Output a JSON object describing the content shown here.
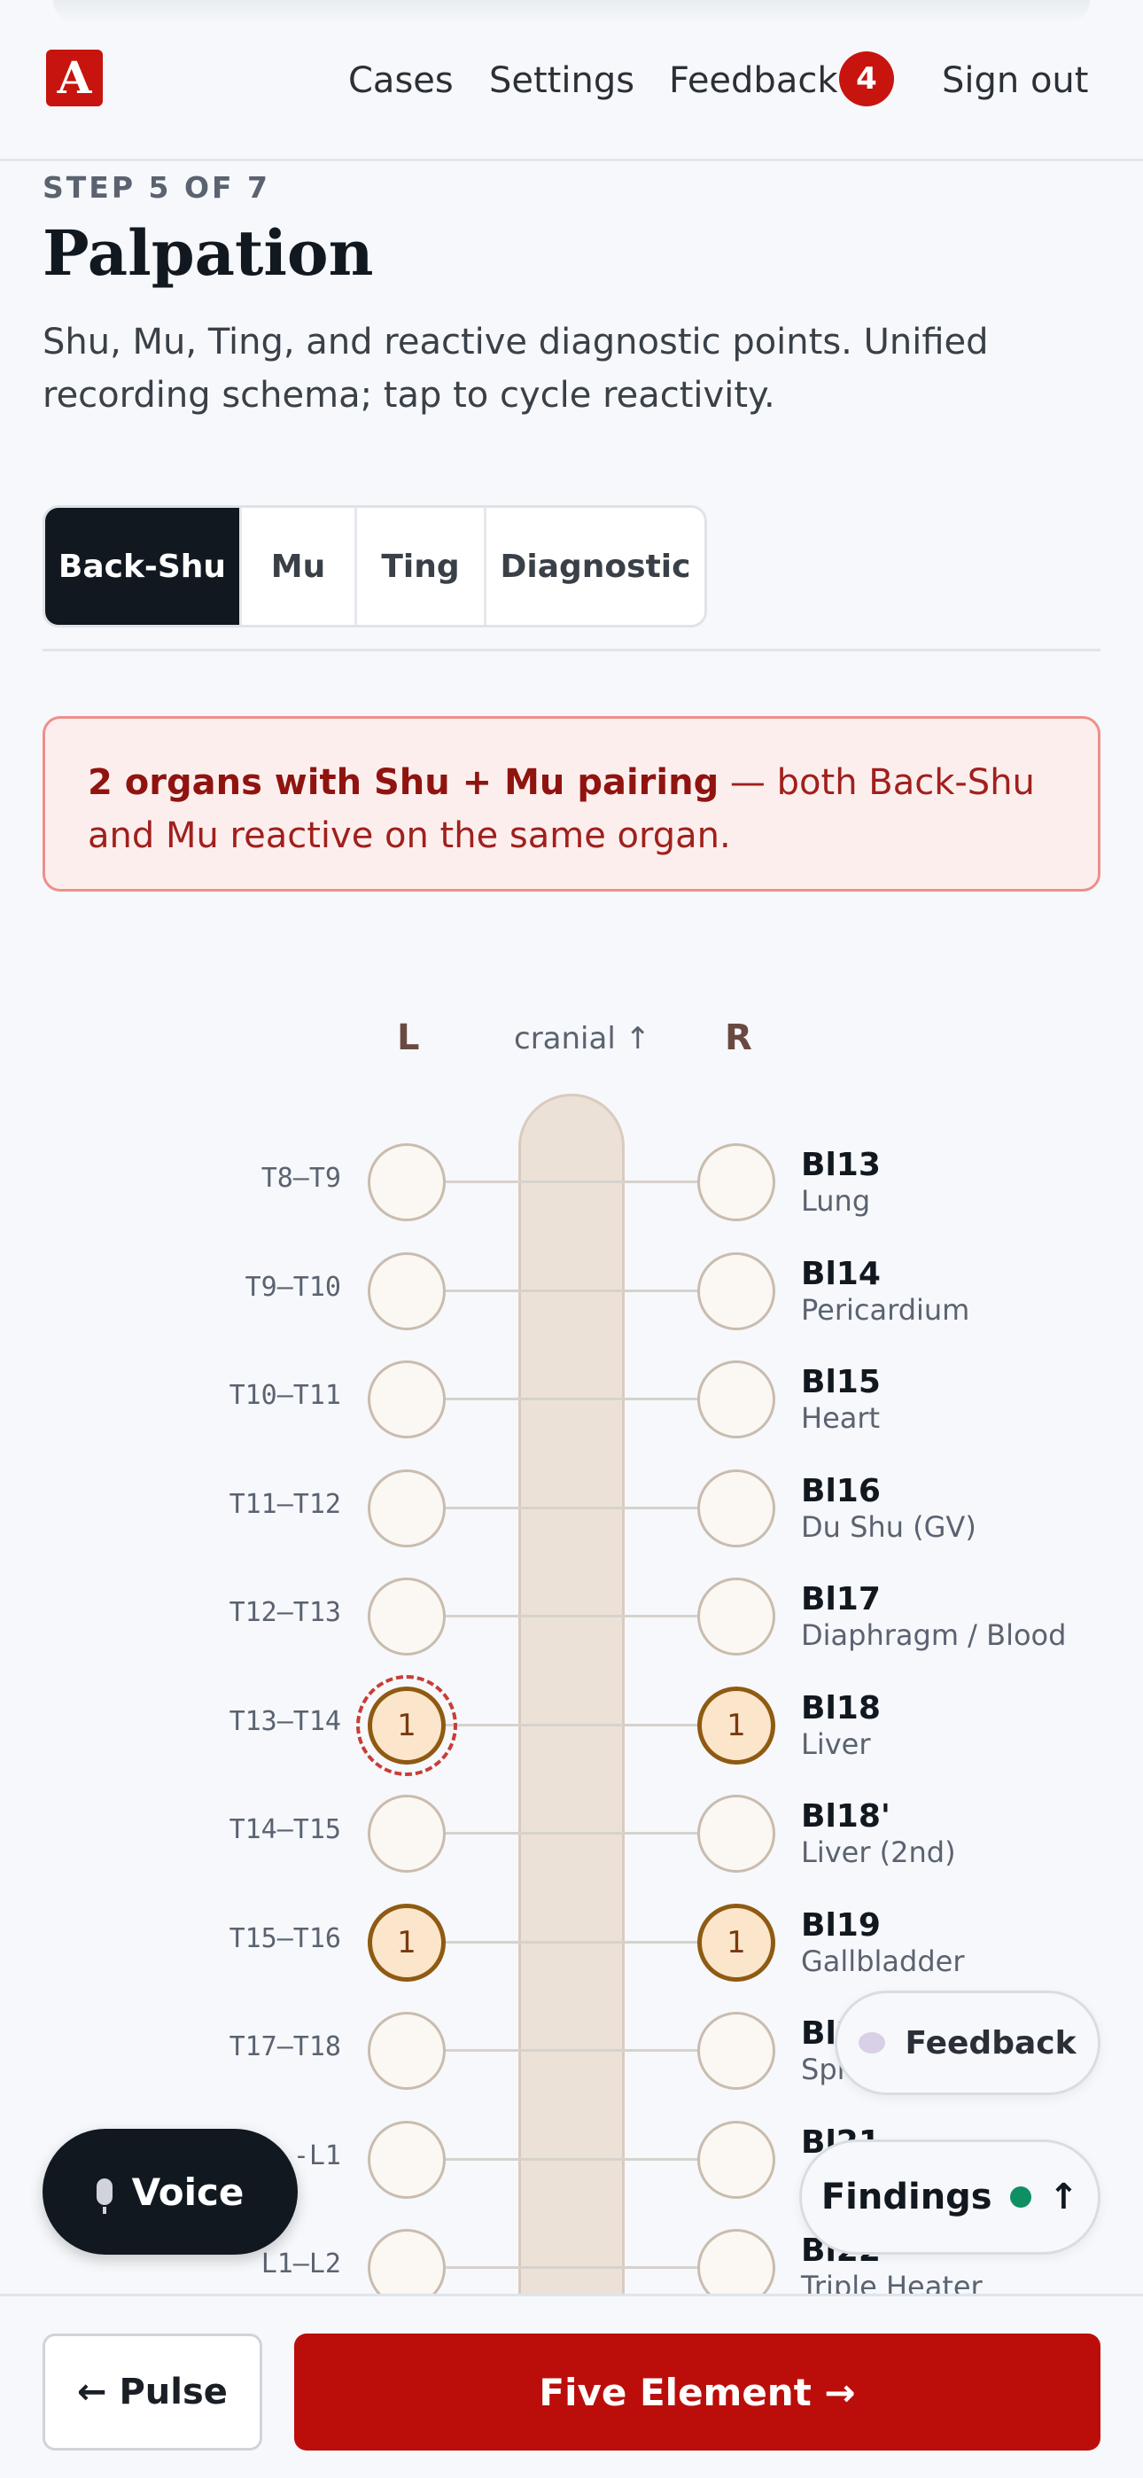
{
  "header": {
    "logo_letter": "A",
    "nav": [
      "Cases",
      "Settings",
      "Feedback",
      "Sign out"
    ],
    "feedback_badge": "4",
    "brand_color": "#c7140e"
  },
  "step": {
    "label": "STEP 5 OF 7",
    "title": "Palpation",
    "description": "Shu, Mu, Ting, and reactive diagnostic points. Unified recording schema; tap to cycle reactivity."
  },
  "tabs": [
    {
      "label": "Back-Shu",
      "active": true
    },
    {
      "label": "Mu",
      "active": false
    },
    {
      "label": "Ting",
      "active": false
    },
    {
      "label": "Diagnostic",
      "active": false
    }
  ],
  "alert": {
    "strong": "2 organs with Shu + Mu pairing",
    "text": " — both Back-Shu and Mu reactive on the same organ."
  },
  "spine": {
    "left_label": "L",
    "center_label": "cranial ↑",
    "right_label": "R",
    "rows": [
      {
        "vertebra": "T8–T9",
        "point": "Bl13",
        "organ": "Lung",
        "left": "",
        "right": ""
      },
      {
        "vertebra": "T9–T10",
        "point": "Bl14",
        "organ": "Pericardium",
        "left": "",
        "right": ""
      },
      {
        "vertebra": "T10–T11",
        "point": "Bl15",
        "organ": "Heart",
        "left": "",
        "right": ""
      },
      {
        "vertebra": "T11–T12",
        "point": "Bl16",
        "organ": "Du Shu (GV)",
        "left": "",
        "right": ""
      },
      {
        "vertebra": "T12–T13",
        "point": "Bl17",
        "organ": "Diaphragm / Blood",
        "left": "",
        "right": ""
      },
      {
        "vertebra": "T13–T14",
        "point": "Bl18",
        "organ": "Liver",
        "left": "1",
        "right": "1",
        "pair": true
      },
      {
        "vertebra": "T14–T15",
        "point": "Bl18'",
        "organ": "Liver (2nd)",
        "left": "",
        "right": ""
      },
      {
        "vertebra": "T15–T16",
        "point": "Bl19",
        "organ": "Gallbladder",
        "left": "1",
        "right": "1"
      },
      {
        "vertebra": "T17–T18",
        "point": "Bl2",
        "organ": "Spl",
        "left": "",
        "right": ""
      },
      {
        "vertebra": "-L1",
        "point": "Bl21",
        "organ": "",
        "left": "",
        "right": ""
      },
      {
        "vertebra": "L1–L2",
        "point": "Bl22",
        "organ": "Triple Heater",
        "left": "",
        "right": ""
      }
    ]
  },
  "floating": {
    "voice": "Voice",
    "feedback": "Feedback",
    "findings": "Findings",
    "findings_arrow": "↑"
  },
  "footer": {
    "prev": "← Pulse",
    "next": "Five Element →"
  }
}
